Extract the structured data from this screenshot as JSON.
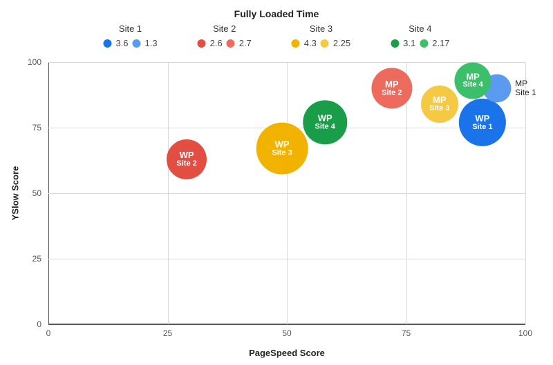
{
  "title": "Fully Loaded Time",
  "legend": {
    "groups": [
      {
        "site": "Site 1",
        "items": [
          {
            "value": "3.6",
            "color": "#1a73e8"
          },
          {
            "value": "1.3",
            "color": "#5a9bf0"
          }
        ]
      },
      {
        "site": "Site 2",
        "items": [
          {
            "value": "2.6",
            "color": "#e34e42"
          },
          {
            "value": "2.7",
            "color": "#ec6b5d"
          }
        ]
      },
      {
        "site": "Site 3",
        "items": [
          {
            "value": "4.3",
            "color": "#f2b300"
          },
          {
            "value": "2.25",
            "color": "#f6c945"
          }
        ]
      },
      {
        "site": "Site 4",
        "items": [
          {
            "value": "3.1",
            "color": "#1a9d49"
          },
          {
            "value": "2.17",
            "color": "#3cbf6a"
          }
        ]
      }
    ]
  },
  "axes": {
    "xlabel": "PageSpeed Score",
    "ylabel": "YSlow Score",
    "x_ticks": [
      0,
      25,
      50,
      75,
      100
    ],
    "y_ticks": [
      0,
      25,
      50,
      75,
      100
    ]
  },
  "points": [
    {
      "site_line": "Site 1",
      "label": "WP",
      "x": 91,
      "y": 77,
      "size": 3.6,
      "color": "#1a73e8",
      "external": false
    },
    {
      "site_line": "Site 1",
      "label": "MP",
      "x": 94,
      "y": 90,
      "size": 1.3,
      "color": "#5a9bf0",
      "external": true
    },
    {
      "site_line": "Site 2",
      "label": "WP",
      "x": 29,
      "y": 63,
      "size": 2.6,
      "color": "#e34e42",
      "external": false
    },
    {
      "site_line": "Site 2",
      "label": "MP",
      "x": 72,
      "y": 90,
      "size": 2.7,
      "color": "#ec6b5d",
      "external": false
    },
    {
      "site_line": "Site 3",
      "label": "WP",
      "x": 49,
      "y": 67,
      "size": 4.3,
      "color": "#f2b300",
      "external": false
    },
    {
      "site_line": "Site 3",
      "label": "MP",
      "x": 82,
      "y": 84,
      "size": 2.25,
      "color": "#f6c945",
      "external": false
    },
    {
      "site_line": "Site 4",
      "label": "WP",
      "x": 58,
      "y": 77,
      "size": 3.1,
      "color": "#1a9d49",
      "external": false
    },
    {
      "site_line": "Site 4",
      "label": "MP",
      "x": 89,
      "y": 93,
      "size": 2.17,
      "color": "#3cbf6a",
      "external": false
    }
  ],
  "chart_data": {
    "type": "scatter",
    "title": "Fully Loaded Time",
    "xlabel": "PageSpeed Score",
    "ylabel": "YSlow Score",
    "xlim": [
      0,
      100
    ],
    "ylim": [
      0,
      100
    ],
    "size_field": "fully_loaded_time_seconds",
    "series": [
      {
        "name": "Site 1",
        "colors": [
          "#1a73e8",
          "#5a9bf0"
        ],
        "points": [
          {
            "label": "WP",
            "pagespeed": 91,
            "yslow": 77,
            "fully_loaded_time_seconds": 3.6
          },
          {
            "label": "MP",
            "pagespeed": 94,
            "yslow": 90,
            "fully_loaded_time_seconds": 1.3
          }
        ]
      },
      {
        "name": "Site 2",
        "colors": [
          "#e34e42",
          "#ec6b5d"
        ],
        "points": [
          {
            "label": "WP",
            "pagespeed": 29,
            "yslow": 63,
            "fully_loaded_time_seconds": 2.6
          },
          {
            "label": "MP",
            "pagespeed": 72,
            "yslow": 90,
            "fully_loaded_time_seconds": 2.7
          }
        ]
      },
      {
        "name": "Site 3",
        "colors": [
          "#f2b300",
          "#f6c945"
        ],
        "points": [
          {
            "label": "WP",
            "pagespeed": 49,
            "yslow": 67,
            "fully_loaded_time_seconds": 4.3
          },
          {
            "label": "MP",
            "pagespeed": 82,
            "yslow": 84,
            "fully_loaded_time_seconds": 2.25
          }
        ]
      },
      {
        "name": "Site 4",
        "colors": [
          "#1a9d49",
          "#3cbf6a"
        ],
        "points": [
          {
            "label": "WP",
            "pagespeed": 58,
            "yslow": 77,
            "fully_loaded_time_seconds": 3.1
          },
          {
            "label": "MP",
            "pagespeed": 89,
            "yslow": 93,
            "fully_loaded_time_seconds": 2.17
          }
        ]
      }
    ]
  }
}
